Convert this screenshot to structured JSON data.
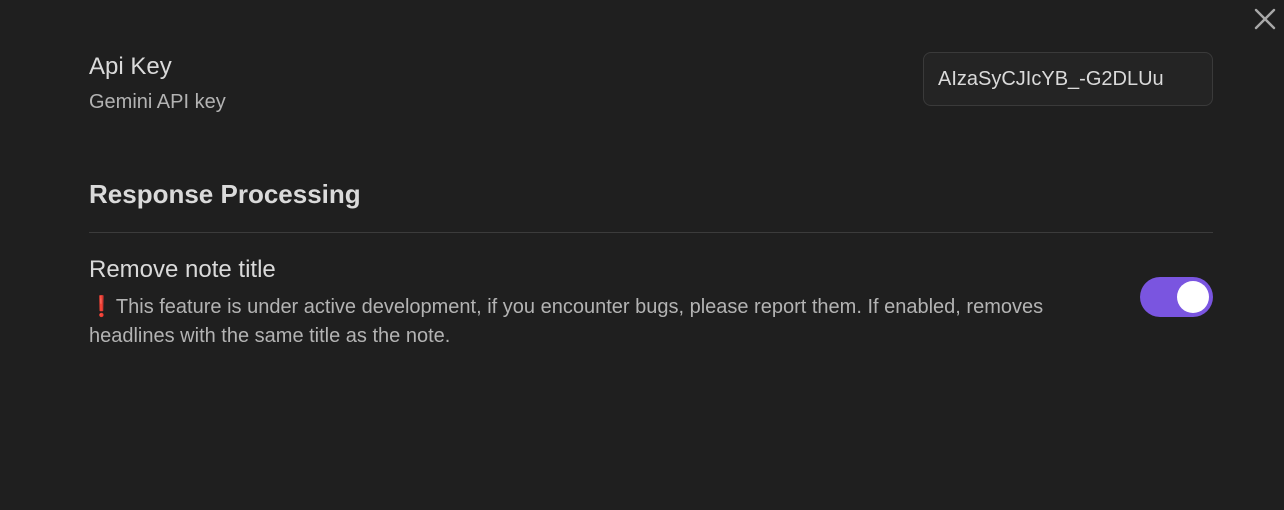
{
  "api_key": {
    "name": "Api Key",
    "description": "Gemini API key",
    "value": "AIzaSyCJIcYB_-G2DLUu"
  },
  "section": {
    "heading": "Response Processing"
  },
  "remove_note_title": {
    "name": "Remove note title",
    "warning_icon": "exclamation-icon",
    "description": "This feature is under active development, if you encounter bugs, please report them. If enabled, removes headlines with the same title as the note.",
    "enabled": true
  },
  "colors": {
    "background": "#1f1f1f",
    "accent": "#7a55e0",
    "warning": "#e5303a"
  }
}
